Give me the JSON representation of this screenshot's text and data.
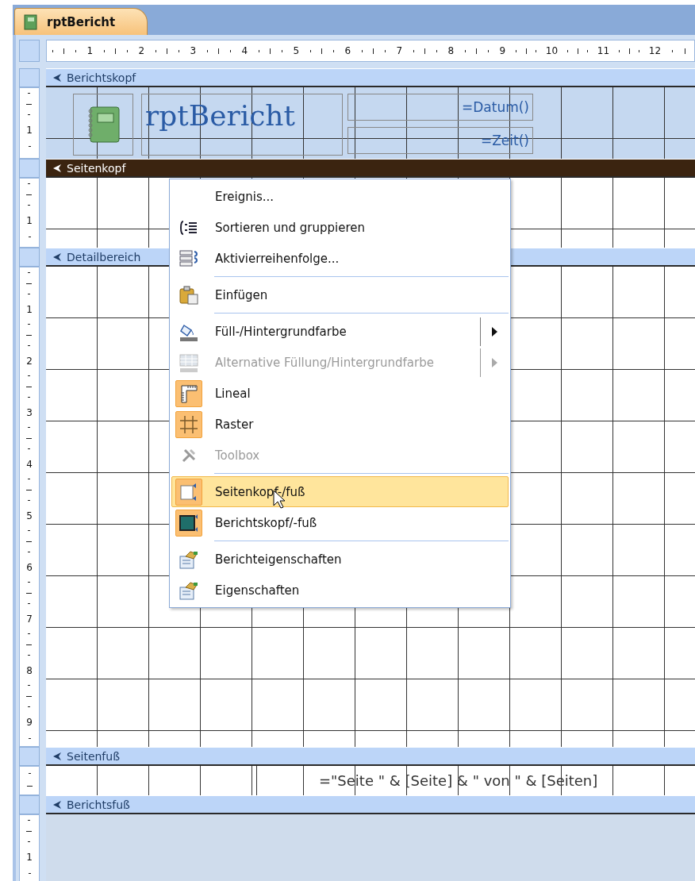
{
  "document_tab": {
    "title": "rptBericht",
    "selected": true
  },
  "ruler": {
    "labels": [
      "1",
      "2",
      "3",
      "4",
      "5",
      "6",
      "7",
      "8",
      "9",
      "10",
      "11",
      "12"
    ]
  },
  "sections": [
    {
      "kind": "report_header",
      "title": "Berichtskopf",
      "selected": false,
      "ruler_labels": [
        "1"
      ],
      "controls": [
        {
          "kind": "logo"
        },
        {
          "kind": "title",
          "text": "rptBericht"
        },
        {
          "kind": "field",
          "text": "=Datum()"
        },
        {
          "kind": "field",
          "text": "=Zeit()"
        }
      ]
    },
    {
      "kind": "page_header",
      "title": "Seitenkopf",
      "selected": true,
      "ruler_labels": [
        "1"
      ]
    },
    {
      "kind": "detail",
      "title": "Detailbereich",
      "selected": false,
      "ruler_labels": [
        "1",
        "2",
        "3",
        "4",
        "5",
        "6",
        "7",
        "8",
        "9"
      ]
    },
    {
      "kind": "page_footer",
      "title": "Seitenfuß",
      "selected": false,
      "controls": [
        {
          "kind": "field",
          "text": "=\"Seite \" & [Seite] & \" von \" & [Seiten]"
        }
      ]
    },
    {
      "kind": "report_footer",
      "title": "Berichtsfuß",
      "selected": false,
      "ruler_labels": [
        "1"
      ]
    }
  ],
  "context_menu": {
    "items": [
      {
        "kind": "item",
        "label": "Ereignis...",
        "disabled": false,
        "checked": false,
        "selected": false,
        "submenu": false
      },
      {
        "kind": "item",
        "label": "Sortieren und gruppieren",
        "disabled": false,
        "checked": false,
        "selected": false,
        "submenu": false
      },
      {
        "kind": "item",
        "label": "Aktivierreihenfolge...",
        "disabled": false,
        "checked": false,
        "selected": false,
        "submenu": false
      },
      {
        "kind": "separator"
      },
      {
        "kind": "item",
        "label": "Einfügen",
        "disabled": false,
        "checked": false,
        "selected": false,
        "submenu": false
      },
      {
        "kind": "separator"
      },
      {
        "kind": "item",
        "label": "Füll-/Hintergrundfarbe",
        "disabled": false,
        "checked": false,
        "selected": false,
        "submenu": true
      },
      {
        "kind": "item",
        "label": "Alternative Füllung/Hintergrundfarbe",
        "disabled": true,
        "checked": false,
        "selected": false,
        "submenu": true
      },
      {
        "kind": "item",
        "label": "Lineal",
        "disabled": false,
        "checked": true,
        "selected": false,
        "submenu": false
      },
      {
        "kind": "item",
        "label": "Raster",
        "disabled": false,
        "checked": true,
        "selected": false,
        "submenu": false
      },
      {
        "kind": "item",
        "label": "Toolbox",
        "disabled": true,
        "checked": false,
        "selected": false,
        "submenu": false
      },
      {
        "kind": "separator"
      },
      {
        "kind": "item",
        "label": "Seitenkopf-/fuß",
        "disabled": false,
        "checked": true,
        "selected": true,
        "submenu": false
      },
      {
        "kind": "item",
        "label": "Berichtskopf/-fuß",
        "disabled": false,
        "checked": true,
        "selected": false,
        "submenu": false
      },
      {
        "kind": "separator"
      },
      {
        "kind": "item",
        "label": "Berichteigenschaften",
        "disabled": false,
        "checked": false,
        "selected": false,
        "submenu": false
      },
      {
        "kind": "item",
        "label": "Eigenschaften",
        "disabled": false,
        "checked": false,
        "selected": false,
        "submenu": false
      }
    ]
  }
}
